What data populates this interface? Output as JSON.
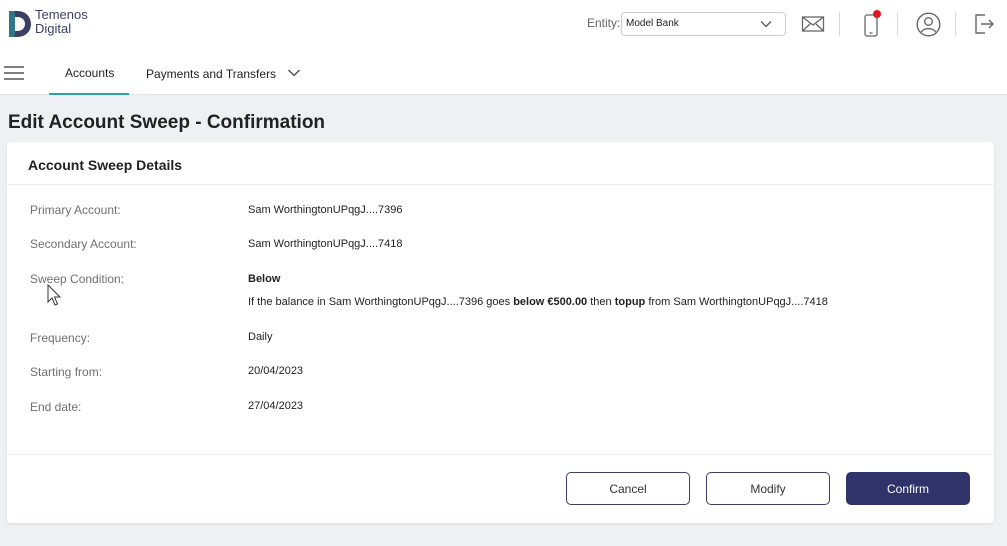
{
  "app": {
    "brand_line1": "Temenos",
    "brand_line2": "Digital"
  },
  "header": {
    "entity_label": "Entity:",
    "entity_value": "Model Bank",
    "notification_color": "#e0161e"
  },
  "nav": {
    "tabs": [
      {
        "label": "Accounts",
        "active": true
      },
      {
        "label": "Payments and Transfers",
        "active": false
      }
    ],
    "accent_color": "#28a3a8"
  },
  "page": {
    "title": "Edit Account Sweep - Confirmation"
  },
  "details": {
    "section_title": "Account Sweep Details",
    "primary_label": "Primary Account:",
    "primary_value": "Sam WorthingtonUPqgJ....7396",
    "secondary_label": "Secondary Account:",
    "secondary_value": "Sam WorthingtonUPqgJ....7418",
    "condition_label": "Sweep Condition:",
    "condition_value": "Below",
    "condition_text": {
      "part1": "If the balance in Sam WorthingtonUPqgJ....7396 goes ",
      "bold1": "below €500.00",
      "part2": " then ",
      "bold2": "topup",
      "part3": " from Sam WorthingtonUPqgJ....7418"
    },
    "frequency_label": "Frequency:",
    "frequency_value": "Daily",
    "start_label": "Starting from:",
    "start_value": "20/04/2023",
    "end_label": "End date:",
    "end_value": "27/04/2023"
  },
  "actions": {
    "cancel_label": "Cancel",
    "modify_label": "Modify",
    "confirm_label": "Confirm",
    "primary_color": "#2f3369"
  }
}
